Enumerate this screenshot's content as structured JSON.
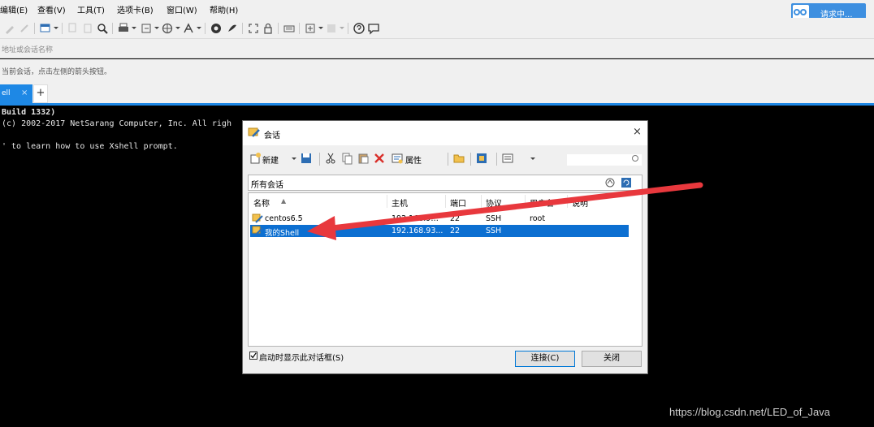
{
  "menubar": {
    "items": [
      "编辑(E)",
      "查看(V)",
      "工具(T)",
      "选项卡(B)",
      "窗口(W)",
      "帮助(H)"
    ],
    "cloud_button": "请求中..."
  },
  "toolbar": {
    "icons": [
      "pencil-icon",
      "edit-icon",
      "new-session-icon",
      "copy-icon",
      "paste-icon",
      "find-icon",
      "print-icon",
      "transfer-icon",
      "globe-icon",
      "font-icon",
      "xshell-icon",
      "xftp-icon",
      "fullscreen-icon",
      "lock-icon",
      "keyboard-icon",
      "compose-icon",
      "layout-icon",
      "help-icon",
      "chat-icon"
    ]
  },
  "addressbar": {
    "placeholder": "地址或会话名称"
  },
  "hintbar": {
    "text": "当前会话，点击左侧的箭头按钮。"
  },
  "tabs": {
    "active_label": "ell",
    "close": "×",
    "add": "+"
  },
  "terminal": {
    "lines": [
      "Build 1332)",
      "(c) 2002-2017 NetSarang Computer, Inc. All righ",
      "",
      "' to learn how to use Xshell prompt."
    ]
  },
  "watermark": "https://blog.csdn.net/LED_of_Java",
  "dialog": {
    "title": "会话",
    "close": "×",
    "toolbar": {
      "new_label": "新建",
      "properties_label": "属性"
    },
    "path": "所有会话",
    "columns": [
      "名称",
      "主机",
      "端口",
      "协议",
      "用户名",
      "说明"
    ],
    "sort_indicator": "▲",
    "rows": [
      {
        "name": "centos6.5",
        "host": "192.168.9…",
        "port": "22",
        "protocol": "SSH",
        "user": "root",
        "selected": false
      },
      {
        "name": "我的Shell",
        "host": "192.168.93...",
        "port": "22",
        "protocol": "SSH",
        "user": "",
        "selected": true
      }
    ],
    "footer": {
      "show_on_startup_label": "启动时显示此对话框(S)",
      "connect_button": "连接(C)",
      "close_button": "关闭"
    }
  },
  "colors": {
    "accent": "#1e88e5",
    "selection": "#0c6fd1",
    "annotation_arrow": "#e8383d",
    "terminal_bg": "#000000"
  }
}
